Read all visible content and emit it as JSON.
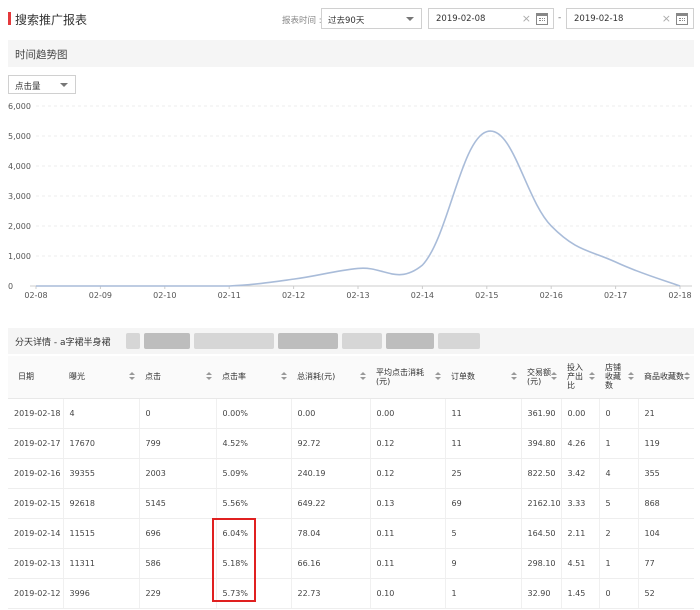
{
  "header": {
    "title": "搜索推广报表",
    "time_label": "报表时间 :",
    "range_value": "过去90天",
    "start_date": "2019-02-08",
    "end_date": "2019-02-18",
    "date_separator": "-",
    "clear_glyph": "×",
    "accent_color": "#e4393c"
  },
  "trend": {
    "section_title": "时间趋势图",
    "metric_value": "点击量"
  },
  "chart_data": {
    "type": "line",
    "x": [
      "02-08",
      "02-09",
      "02-10",
      "02-11",
      "02-12",
      "02-13",
      "02-14",
      "02-15",
      "02-16",
      "02-17",
      "02-18"
    ],
    "series": [
      {
        "values": [
          0,
          0,
          0,
          0,
          229,
          586,
          696,
          5145,
          2003,
          799,
          0
        ]
      }
    ],
    "yticks": [
      "0",
      "1,000",
      "2,000",
      "3,000",
      "4,000",
      "5,000",
      "6,000"
    ],
    "ylim": [
      0,
      6000
    ],
    "grid": "horizontal-dashed",
    "line_color": "#a9bcd9"
  },
  "detail": {
    "title": "分天详情 - a字裙半身裙"
  },
  "table": {
    "headers": [
      "日期",
      "曝光",
      "点击",
      "点击率",
      "总消耗(元)",
      "平均点击消耗(元)",
      "订单数",
      "交易额(元)",
      "投入产出比",
      "店铺收藏数",
      "商品收藏数"
    ],
    "rows": [
      [
        "2019-02-18",
        "4",
        "0",
        "0.00%",
        "0.00",
        "0.00",
        "11",
        "361.90",
        "0.00",
        "0",
        "21"
      ],
      [
        "2019-02-17",
        "17670",
        "799",
        "4.52%",
        "92.72",
        "0.12",
        "11",
        "394.80",
        "4.26",
        "1",
        "119"
      ],
      [
        "2019-02-16",
        "39355",
        "2003",
        "5.09%",
        "240.19",
        "0.12",
        "25",
        "822.50",
        "3.42",
        "4",
        "355"
      ],
      [
        "2019-02-15",
        "92618",
        "5145",
        "5.56%",
        "649.22",
        "0.13",
        "69",
        "2162.10",
        "3.33",
        "5",
        "868"
      ],
      [
        "2019-02-14",
        "11515",
        "696",
        "6.04%",
        "78.04",
        "0.11",
        "5",
        "164.50",
        "2.11",
        "2",
        "104"
      ],
      [
        "2019-02-13",
        "11311",
        "586",
        "5.18%",
        "66.16",
        "0.11",
        "9",
        "298.10",
        "4.51",
        "1",
        "77"
      ],
      [
        "2019-02-12",
        "3996",
        "229",
        "5.73%",
        "22.73",
        "0.10",
        "1",
        "32.90",
        "1.45",
        "0",
        "52"
      ]
    ]
  }
}
